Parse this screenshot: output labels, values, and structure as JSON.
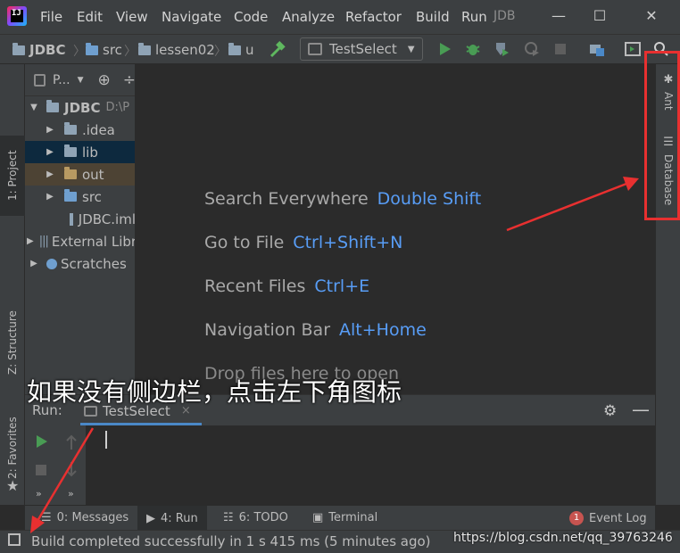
{
  "menubar": {
    "items": [
      {
        "label": "File",
        "mnemonic": "F"
      },
      {
        "label": "Edit",
        "mnemonic": "E"
      },
      {
        "label": "View",
        "mnemonic": "V"
      },
      {
        "label": "Navigate",
        "mnemonic": "N"
      },
      {
        "label": "Code",
        "mnemonic": "C"
      },
      {
        "label": "Analyze",
        "mnemonic": "z"
      },
      {
        "label": "Refactor",
        "mnemonic": "R"
      },
      {
        "label": "Build",
        "mnemonic": "B"
      },
      {
        "label": "Run",
        "mnemonic": "u"
      }
    ],
    "window_title": "JDB",
    "logo_text": "IJ"
  },
  "toolbar": {
    "breadcrumbs": [
      "JDBC",
      "src",
      "lessen02",
      "u"
    ],
    "run_config": "TestSelect"
  },
  "left_stripe": {
    "project_tab": "1: Project",
    "structure_tab": "Z: Structure",
    "favorites_tab": "2: Favorites"
  },
  "project_panel": {
    "header": "P...",
    "tree": [
      {
        "label": "JDBC",
        "suffix": "D:\\P",
        "expanded": true
      },
      {
        "label": ".idea"
      },
      {
        "label": "lib"
      },
      {
        "label": "out"
      },
      {
        "label": "src"
      },
      {
        "label": "JDBC.iml"
      },
      {
        "label": "External Libraries"
      },
      {
        "label": "Scratches"
      }
    ]
  },
  "editor": {
    "hints": [
      {
        "text": "Search Everywhere",
        "key": "Double Shift"
      },
      {
        "text": "Go to File",
        "key": "Ctrl+Shift+N"
      },
      {
        "text": "Recent Files",
        "key": "Ctrl+E"
      },
      {
        "text": "Navigation Bar",
        "key": "Alt+Home"
      }
    ],
    "drop_hint": "Drop files here to open"
  },
  "right_stripe": {
    "ant": "Ant",
    "database": "Database"
  },
  "run_panel": {
    "label": "Run:",
    "tab": "TestSelect",
    "close": "×"
  },
  "caption": "如果没有侧边栏，点击左下角图标",
  "bottom_tabs": {
    "messages": "0: Messages",
    "run": "4: Run",
    "todo": "6: TODO",
    "terminal": "Terminal",
    "event_log": "Event Log",
    "event_count": "1"
  },
  "status": {
    "text": "Build completed successfully in 1 s 415 ms (5 minutes ago)",
    "watermark": "https://blog.csdn.net/qq_39763246"
  },
  "colors": {
    "accent_blue": "#589df6",
    "highlight_red": "#e83030",
    "run_green": "#499c54"
  }
}
